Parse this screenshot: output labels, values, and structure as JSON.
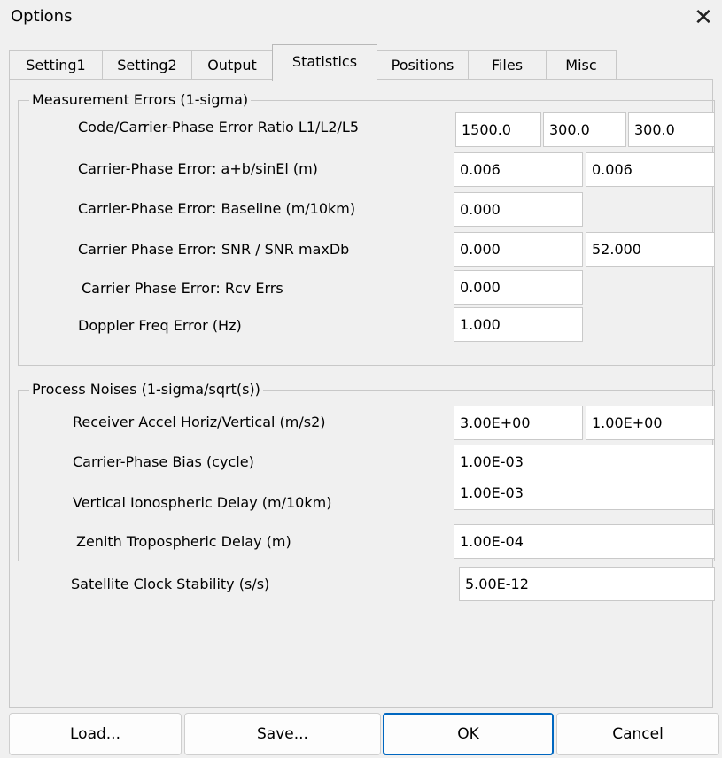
{
  "window": {
    "title": "Options",
    "close_glyph": "✕"
  },
  "tabs": [
    {
      "label": "Setting1"
    },
    {
      "label": "Setting2"
    },
    {
      "label": "Output"
    },
    {
      "label": "Statistics"
    },
    {
      "label": "Positions"
    },
    {
      "label": "Files"
    },
    {
      "label": "Misc"
    }
  ],
  "active_tab": "Statistics",
  "measurement": {
    "title": "Measurement Errors (1-sigma)",
    "ratio": {
      "label": "Code/Carrier-Phase Error Ratio L1/L2/L5",
      "l1": "1500.0",
      "l2": "300.0",
      "l5": "300.0"
    },
    "ab": {
      "label": "Carrier-Phase Error: a+b/sinEl (m)",
      "a": "0.006",
      "b": "0.006"
    },
    "baseline": {
      "label": "Carrier-Phase Error: Baseline (m/10km)",
      "value": "0.000"
    },
    "snr": {
      "label": "Carrier Phase Error: SNR / SNR maxDb",
      "snr": "0.000",
      "maxdb": "52.000"
    },
    "rcv": {
      "label": "Carrier Phase Error: Rcv Errs",
      "value": "0.000"
    },
    "doppler": {
      "label": "Doppler Freq Error (Hz)",
      "value": "1.000"
    }
  },
  "process": {
    "title": "Process Noises (1-sigma/sqrt(s))",
    "accel": {
      "label": "Receiver Accel Horiz/Vertical (m/s2)",
      "horiz": "3.00E+00",
      "vert": "1.00E+00"
    },
    "bias": {
      "label": "Carrier-Phase Bias (cycle)",
      "value": "1.00E-03"
    },
    "iono": {
      "label": "Vertical Ionospheric Delay (m/10km)",
      "value": "1.00E-03"
    },
    "tropo": {
      "label": "Zenith Tropospheric Delay (m)",
      "value": "1.00E-04"
    }
  },
  "clock": {
    "label": "Satellite Clock Stability (s/s)",
    "value": "5.00E-12"
  },
  "buttons": {
    "load": "Load...",
    "save": "Save...",
    "ok": "OK",
    "cancel": "Cancel"
  }
}
